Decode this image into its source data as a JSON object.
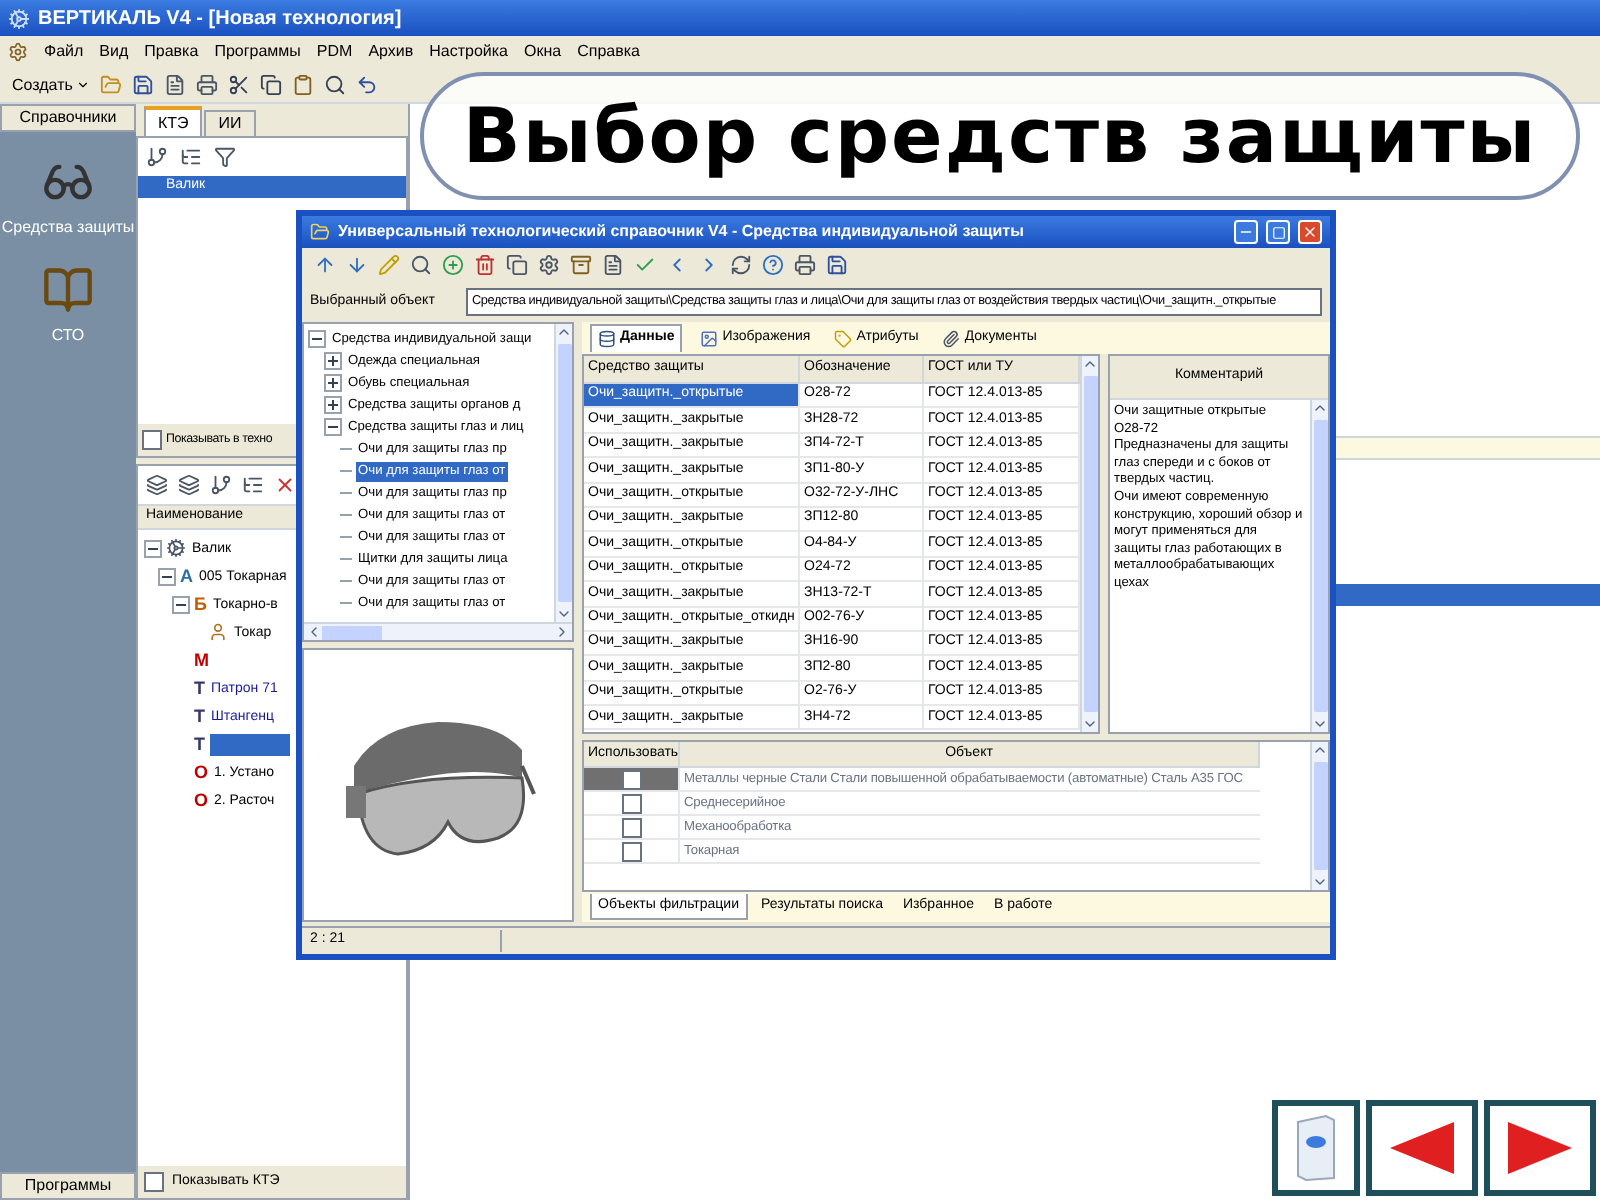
{
  "app": {
    "title": "ВЕРТИКАЛЬ V4 - [Новая технология]",
    "menu": [
      "Файл",
      "Вид",
      "Правка",
      "Программы",
      "PDM",
      "Архив",
      "Настройка",
      "Окна",
      "Справка"
    ],
    "create_button": "Создать",
    "sidebar": {
      "header": "Справочники",
      "items": [
        {
          "label": "Средства защиты",
          "kind": "goggles"
        },
        {
          "label": "СТО",
          "kind": "book"
        }
      ],
      "footer": "Программы"
    },
    "tabs": [
      {
        "label": "КТЭ",
        "selected": true
      },
      {
        "label": "ИИ",
        "selected": false
      }
    ],
    "top_tree": [
      {
        "label": "Валик",
        "selected": true
      }
    ],
    "show_in_tech": {
      "label": "Показывать в техно",
      "checked": false
    },
    "column_header": "Наименование",
    "tree": [
      {
        "label": "Валик",
        "kind": "part",
        "expanded": true,
        "selected": false,
        "children": [
          {
            "label": "005 Токарная",
            "kind": "operation",
            "badge": "А",
            "expanded": true,
            "selected": false,
            "children": [
              {
                "label": "Токарно-в",
                "kind": "transition",
                "badge": "Б",
                "expanded": true,
                "selected": false,
                "children": [
                  {
                    "label": "Токар",
                    "kind": "worker",
                    "selected": false
                  }
                ]
              },
              {
                "kind": "material",
                "badge": "М",
                "selected": false
              },
              {
                "label": "Патрон 71",
                "kind": "tool",
                "badge": "Т",
                "selected": false
              },
              {
                "label": "Штангенц",
                "kind": "tool",
                "badge": "Т",
                "selected": false
              },
              {
                "kind": "tool",
                "badge": "Т",
                "selected": true
              },
              {
                "label": "1. Устано",
                "kind": "step",
                "badge": "О",
                "selected": false
              },
              {
                "label": "2. Расточ",
                "kind": "step",
                "badge": "О",
                "selected": false
              }
            ]
          }
        ]
      }
    ],
    "show_kte": {
      "label": "Показывать КТЭ",
      "checked": false
    }
  },
  "slide_title": "Выбор средств защиты",
  "dialog": {
    "title": "Универсальный технологический справочник V4 - Средства индивидуальной защиты",
    "selected_object_label": "Выбранный объект",
    "selected_object": "Средства индивидуальной защиты\\Средства защиты глаз и лица\\Очи для защиты глаз от воздействия твердых частиц\\Очи_защитн._открытые",
    "tree": [
      {
        "label": "Средства индивидуальной защи",
        "expanded": true,
        "selected": false,
        "children": [
          {
            "label": "Одежда специальная",
            "expanded": false,
            "selected": false
          },
          {
            "label": "Обувь специальная",
            "expanded": false,
            "selected": false
          },
          {
            "label": "Средства защиты органов д",
            "expanded": false,
            "selected": false
          },
          {
            "label": "Средства защиты глаз и лиц",
            "expanded": true,
            "selected": false,
            "children": [
              {
                "label": "Очи для защиты глаз пр",
                "selected": false
              },
              {
                "label": "Очи для защиты глаз от",
                "selected": true
              },
              {
                "label": "Очи для защиты глаз пр",
                "selected": false
              },
              {
                "label": "Очи для защиты глаз от",
                "selected": false
              },
              {
                "label": "Очи для защиты глаз от",
                "selected": false
              },
              {
                "label": "Щитки для защиты лица",
                "selected": false
              },
              {
                "label": "Очи для защиты глаз от",
                "selected": false
              },
              {
                "label": "Очи для защиты глаз от",
                "selected": false
              }
            ]
          }
        ]
      }
    ],
    "tabs": [
      {
        "label": "Данные",
        "kind": "data",
        "selected": true
      },
      {
        "label": "Изображения",
        "kind": "images",
        "selected": false
      },
      {
        "label": "Атрибуты",
        "kind": "attributes",
        "selected": false
      },
      {
        "label": "Документы",
        "kind": "documents",
        "selected": false
      }
    ],
    "table": {
      "columns": [
        "Средство защиты",
        "Обозначение",
        "ГОСТ или ТУ"
      ],
      "rows": [
        {
          "cells": [
            "Очи_защитн._открытые",
            "О28-72",
            "ГОСТ 12.4.013-85"
          ],
          "selected": true
        },
        {
          "cells": [
            "Очи_защитн._закрытые",
            "ЗН28-72",
            "ГОСТ 12.4.013-85"
          ],
          "selected": false
        },
        {
          "cells": [
            "Очи_защитн._закрытые",
            "ЗП4-72-Т",
            "ГОСТ 12.4.013-85"
          ],
          "selected": false
        },
        {
          "cells": [
            "Очи_защитн._закрытые",
            "ЗП1-80-У",
            "ГОСТ 12.4.013-85"
          ],
          "selected": false
        },
        {
          "cells": [
            "Очи_защитн._открытые",
            "О32-72-У-ЛНС",
            "ГОСТ 12.4.013-85"
          ],
          "selected": false
        },
        {
          "cells": [
            "Очи_защитн._закрытые",
            "ЗП12-80",
            "ГОСТ 12.4.013-85"
          ],
          "selected": false
        },
        {
          "cells": [
            "Очи_защитн._открытые",
            "О4-84-У",
            "ГОСТ 12.4.013-85"
          ],
          "selected": false
        },
        {
          "cells": [
            "Очи_защитн._открытые",
            "О24-72",
            "ГОСТ 12.4.013-85"
          ],
          "selected": false
        },
        {
          "cells": [
            "Очи_защитн._закрытые",
            "ЗН13-72-Т",
            "ГОСТ 12.4.013-85"
          ],
          "selected": false
        },
        {
          "cells": [
            "Очи_защитн._открытые_откидн",
            "О02-76-У",
            "ГОСТ 12.4.013-85"
          ],
          "selected": false
        },
        {
          "cells": [
            "Очи_защитн._закрытые",
            "ЗН16-90",
            "ГОСТ 12.4.013-85"
          ],
          "selected": false
        },
        {
          "cells": [
            "Очи_защитн._закрытые",
            "ЗП2-80",
            "ГОСТ 12.4.013-85"
          ],
          "selected": false
        },
        {
          "cells": [
            "Очи_защитн._открытые",
            "О2-76-У",
            "ГОСТ 12.4.013-85"
          ],
          "selected": false
        },
        {
          "cells": [
            "Очи_защитн._закрытые",
            "ЗН4-72",
            "ГОСТ 12.4.013-85"
          ],
          "selected": false
        }
      ]
    },
    "comment": {
      "header": "Комментарий",
      "paragraphs": [
        "Очи защитные открытые",
        "О28-72",
        "Предназначены для защиты глаз спереди и с боков от твердых частиц.",
        "Очи имеют современную конструкцию, хороший обзор и могут применяться для защиты глаз работающих в металлообрабатывающих цехах"
      ]
    },
    "filter_grid": {
      "columns": [
        "Использовать",
        "Объект"
      ],
      "rows": [
        {
          "object": "Металлы черные Стали Стали повышенной обрабатываемости (автоматные) Сталь А35 ГОС",
          "checked": false,
          "selected": true
        },
        {
          "object": "Среднесерийное",
          "checked": false,
          "selected": false
        },
        {
          "object": "Механообработка",
          "checked": false,
          "selected": false
        },
        {
          "object": "Токарная",
          "checked": false,
          "selected": false
        }
      ]
    },
    "bottom_tabs": [
      {
        "label": "Объекты фильтрации",
        "selected": true
      },
      {
        "label": "Результаты поиска",
        "selected": false
      },
      {
        "label": "Избранное",
        "selected": false
      },
      {
        "label": "В работе",
        "selected": false
      }
    ],
    "status": "2 : 21"
  }
}
